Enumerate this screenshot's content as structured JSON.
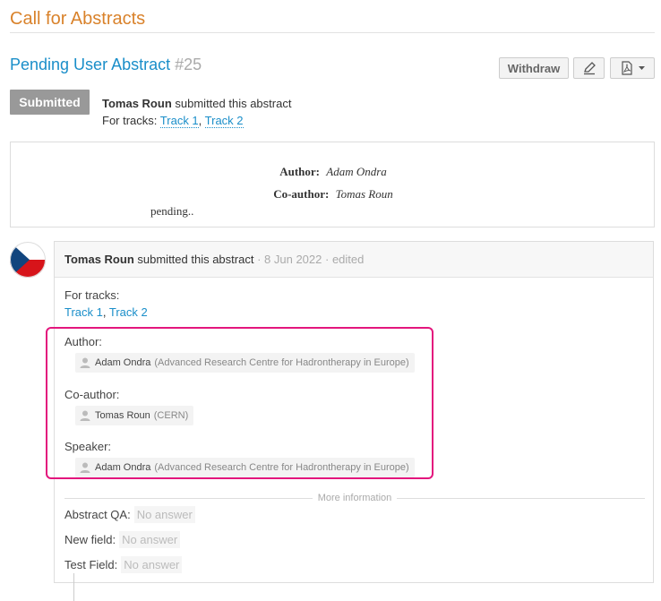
{
  "page": {
    "title": "Call for Abstracts"
  },
  "abstract": {
    "title": "Pending User Abstract",
    "number": "#25",
    "status": "Submitted",
    "submitter": "Tomas Roun",
    "submitted_text": "submitted this abstract",
    "tracks_label": "For tracks:",
    "tracks": [
      "Track 1",
      "Track 2"
    ]
  },
  "actions": {
    "withdraw": "Withdraw",
    "edit_icon": "pencil-icon",
    "pdf_icon": "pdf-icon"
  },
  "content": {
    "author_label": "Author:",
    "author": "Adam Ondra",
    "coauthor_label": "Co-author:",
    "coauthor": "Tomas Roun",
    "body": "pending.."
  },
  "timeline": {
    "avatar": "czech-flag-avatar",
    "header_user": "Tomas Roun",
    "header_action": "submitted this abstract",
    "date": "8 Jun 2022",
    "edited": "edited",
    "tracks_label": "For tracks:",
    "tracks": [
      "Track 1",
      "Track 2"
    ],
    "author_label": "Author:",
    "author": {
      "name": "Adam Ondra",
      "affiliation": "(Advanced Research Centre for Hadrontherapy in Europe)"
    },
    "coauthor_label": "Co-author:",
    "coauthor": {
      "name": "Tomas Roun",
      "affiliation": "(CERN)"
    },
    "speaker_label": "Speaker:",
    "speaker": {
      "name": "Adam Ondra",
      "affiliation": "(Advanced Research Centre for Hadrontherapy in Europe)"
    },
    "more_info": "More information",
    "fields": [
      {
        "label": "Abstract QA:",
        "value": "No answer"
      },
      {
        "label": "New field:",
        "value": "No answer"
      },
      {
        "label": "Test Field:",
        "value": "No answer"
      }
    ]
  },
  "colors": {
    "accent": "#d9822b",
    "link": "#1a8ec9",
    "highlight": "#e3167d"
  }
}
